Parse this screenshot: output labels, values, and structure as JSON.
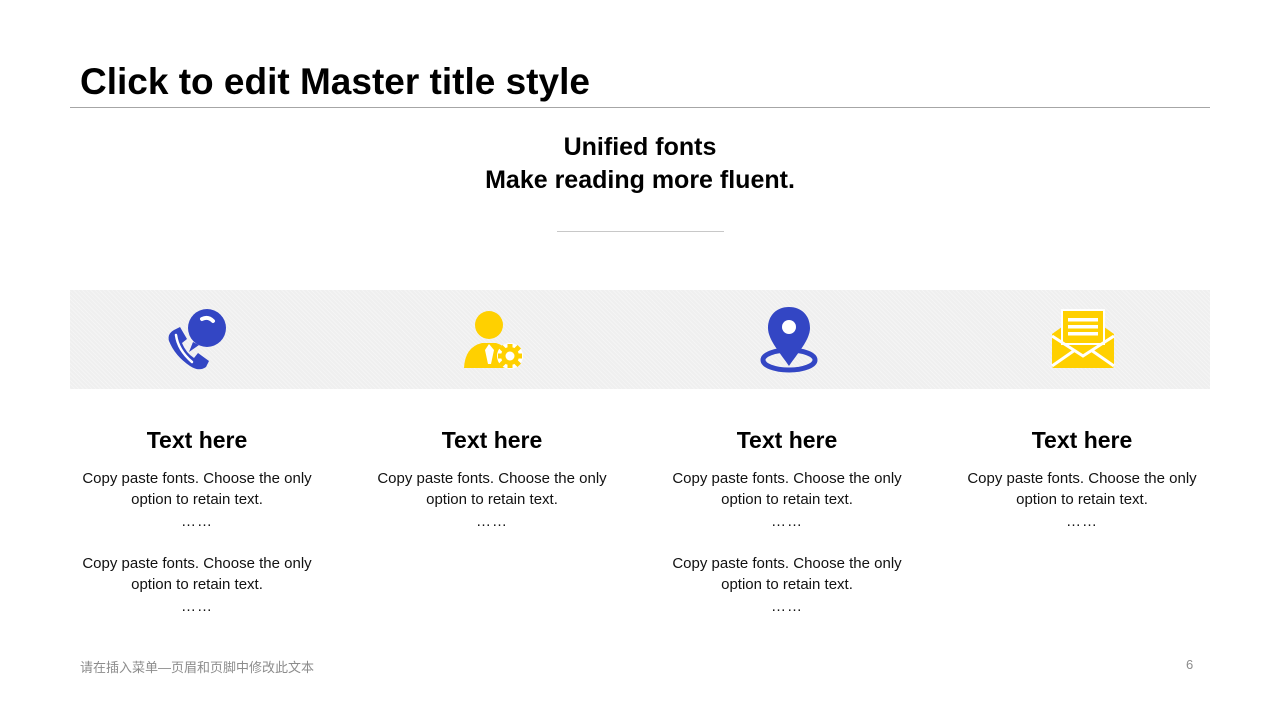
{
  "slide": {
    "title": "Click to edit Master title style",
    "headline_line1": "Unified fonts",
    "headline_line2": "Make reading more fluent."
  },
  "icons": {
    "col1": "phone-chat-icon",
    "col2": "user-settings-icon",
    "col3": "location-pin-icon",
    "col4": "envelope-letter-icon"
  },
  "colors": {
    "blue": "#3346c4",
    "yellow": "#ffd000",
    "band": "#efefef"
  },
  "columns": [
    {
      "heading": "Text here",
      "paragraphs": [
        {
          "line1": "Copy paste fonts. Choose the only",
          "line2": "option to retain text.",
          "dots": "……"
        },
        {
          "line1": "Copy paste fonts. Choose the only",
          "line2": "option to retain text.",
          "dots": "……"
        }
      ]
    },
    {
      "heading": "Text here",
      "paragraphs": [
        {
          "line1": "Copy paste fonts. Choose the only",
          "line2": "option to retain text.",
          "dots": "……"
        }
      ]
    },
    {
      "heading": "Text here",
      "paragraphs": [
        {
          "line1": "Copy paste fonts. Choose the only",
          "line2": "option to retain text.",
          "dots": "……"
        },
        {
          "line1": "Copy paste fonts. Choose the only",
          "line2": "option to retain text.",
          "dots": "……"
        }
      ]
    },
    {
      "heading": "Text here",
      "paragraphs": [
        {
          "line1": "Copy paste fonts. Choose the only",
          "line2": "option to retain text.",
          "dots": "……"
        }
      ]
    }
  ],
  "footer": {
    "text": "请在插入菜单—页眉和页脚中修改此文本",
    "page_number": "6"
  }
}
